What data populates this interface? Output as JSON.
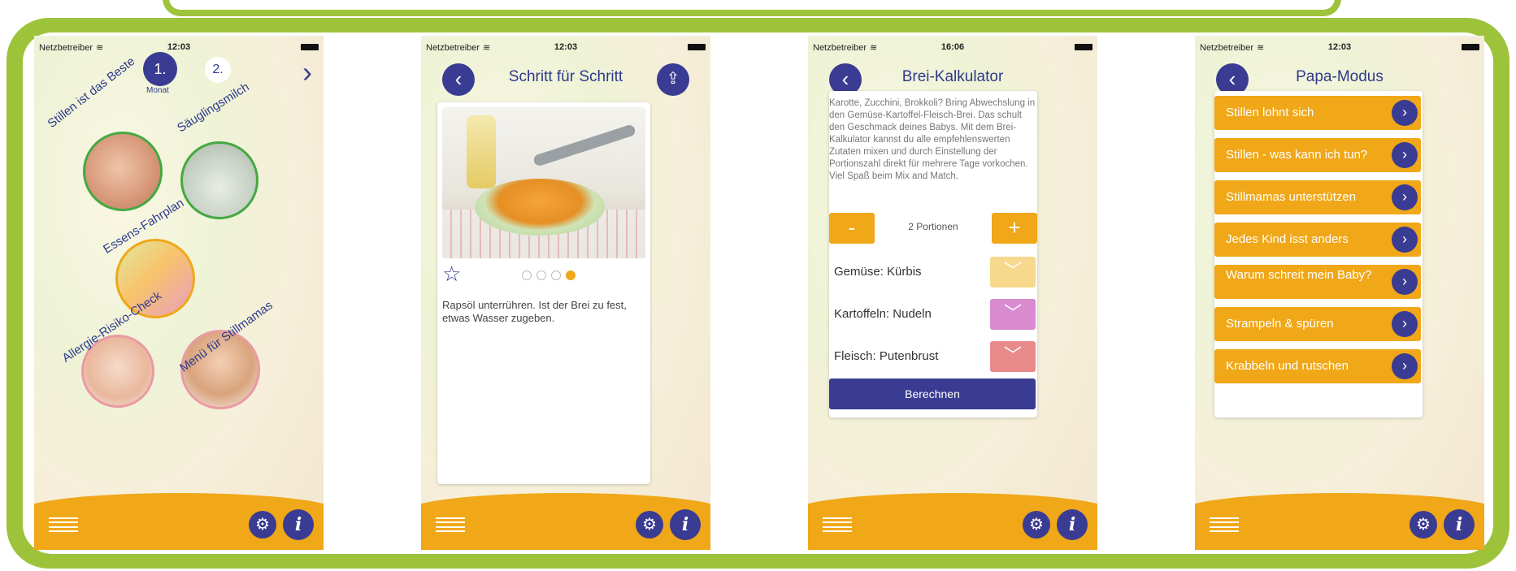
{
  "status": {
    "carrier": "Netzbetreiber",
    "screen1_time": "12:03",
    "screen2_time": "12:03",
    "screen3_time": "16:06",
    "screen4_time": "12:03"
  },
  "screen1": {
    "month_active": "1.",
    "month_label": "Monat",
    "month_next": "2.",
    "tiles": [
      {
        "label": "Stillen ist das Beste"
      },
      {
        "label": "Säuglingsmilch"
      },
      {
        "label": "Essens-Fahrplan"
      },
      {
        "label": "Allergie-Risiko-Check"
      },
      {
        "label": "Menü für Stillmamas"
      }
    ]
  },
  "screen2": {
    "title": "Schritt für Schritt",
    "step_text": "Rapsöl unterrühren. Ist der Brei zu fest, etwas Wasser zugeben.",
    "page_count": 4,
    "active_page": 4
  },
  "screen3": {
    "title": "Brei-Kalkulator",
    "intro": "Karotte, Zucchini, Brokkoli? Bring Abwechslung in den Gemüse-Kartoffel-Fleisch-Brei. Das schult den Geschmack deines Babys. Mit dem Brei-Kalkulator kannst du alle empfehlenswerten Zutaten mixen und durch Einstellung der Portionszahl direkt für mehrere Tage vorkochen. Viel Spaß beim Mix and Match.",
    "minus_label": "-",
    "plus_label": "+",
    "portions": "2 Portionen",
    "selections": [
      {
        "label": "Gemüse: Kürbis",
        "color": "#f6d98c"
      },
      {
        "label": "Kartoffeln: Nudeln",
        "color": "#d98bd0"
      },
      {
        "label": "Fleisch: Putenbrust",
        "color": "#e98a8a"
      }
    ],
    "calc_button": "Berechnen"
  },
  "screen4": {
    "title": "Papa-Modus",
    "items": [
      {
        "label": "Stillen lohnt sich"
      },
      {
        "label": "Stillen - was kann ich tun?"
      },
      {
        "label": "Stillmamas unterstützen"
      },
      {
        "label": "Jedes Kind isst anders"
      },
      {
        "label": "Warum schreit mein Baby?"
      },
      {
        "label": "Strampeln & spüren"
      },
      {
        "label": "Krabbeln und rutschen"
      }
    ]
  },
  "colors": {
    "frame_green": "#9dc33b",
    "accent_orange": "#f0a718",
    "navy": "#3a3b92"
  },
  "icons": {
    "back": "chevron-left-icon",
    "share": "share-icon",
    "settings": "gear-icon",
    "info": "info-icon",
    "menu": "hamburger-icon",
    "favorite": "star-icon",
    "dropdown": "chevron-down-icon"
  }
}
